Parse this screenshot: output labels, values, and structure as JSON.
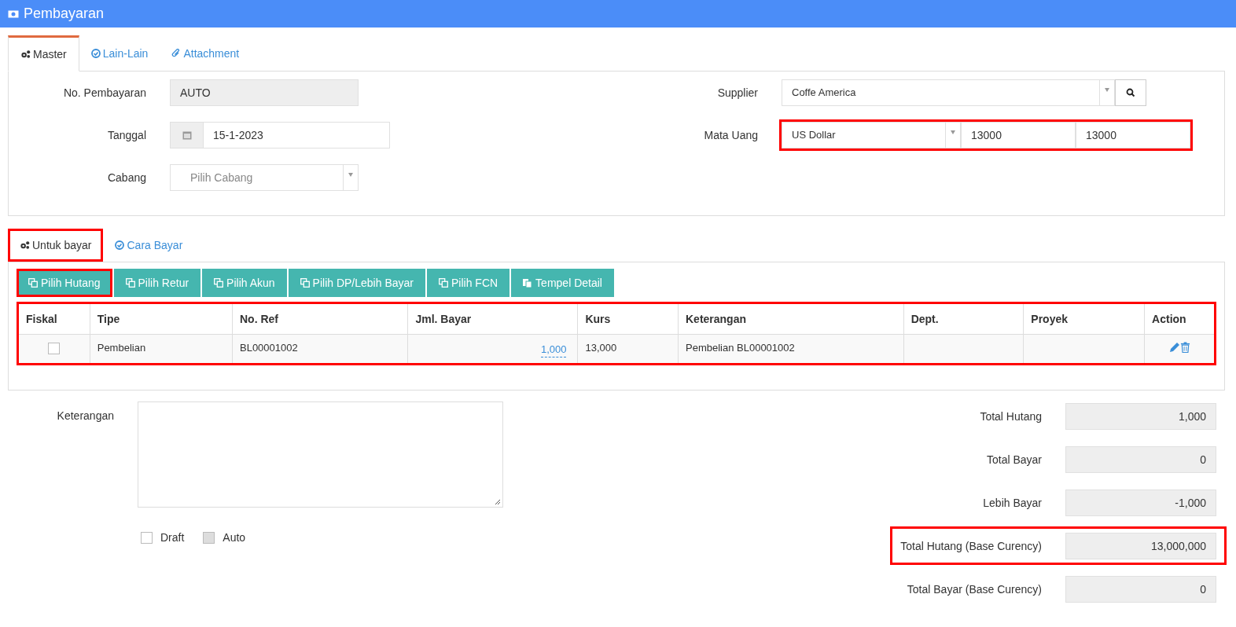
{
  "header": {
    "title": "Pembayaran"
  },
  "master_tabs": [
    {
      "label": "Master",
      "kind": "gears",
      "selected": true
    },
    {
      "label": "Lain-Lain",
      "kind": "check",
      "selected": false
    },
    {
      "label": "Attachment",
      "kind": "clip",
      "selected": false
    }
  ],
  "master": {
    "no_pembayaran": {
      "label": "No. Pembayaran",
      "value": "AUTO"
    },
    "tanggal": {
      "label": "Tanggal",
      "value": "15-1-2023"
    },
    "cabang": {
      "label": "Cabang",
      "placeholder": "Pilih Cabang"
    },
    "supplier": {
      "label": "Supplier",
      "value": "Coffe America"
    },
    "mata_uang": {
      "label": "Mata Uang",
      "currency": "US Dollar",
      "rate_1": "13000",
      "rate_2": "13000",
      "highlighted": true
    }
  },
  "detail_tabs": [
    {
      "label": "Untuk bayar",
      "kind": "gears",
      "selected": true,
      "highlighted": true
    },
    {
      "label": "Cara Bayar",
      "kind": "check",
      "selected": false,
      "highlighted": false
    }
  ],
  "toolbar": [
    {
      "label": "Pilih Hutang",
      "kind": "copy",
      "highlighted": true
    },
    {
      "label": "Pilih Retur",
      "kind": "copy",
      "highlighted": false
    },
    {
      "label": "Pilih Akun",
      "kind": "copy",
      "highlighted": false
    },
    {
      "label": "Pilih DP/Lebih Bayar",
      "kind": "copy",
      "highlighted": false
    },
    {
      "label": "Pilih FCN",
      "kind": "copy",
      "highlighted": false
    },
    {
      "label": "Tempel Detail",
      "kind": "paste",
      "highlighted": false
    }
  ],
  "table": {
    "highlighted": true,
    "columns": [
      "Fiskal",
      "Tipe",
      "No. Ref",
      "Jml. Bayar",
      "Kurs",
      "Keterangan",
      "Dept.",
      "Proyek",
      "Action"
    ],
    "rows": [
      {
        "fiskal_checked": false,
        "tipe": "Pembelian",
        "no_ref": "BL00001002",
        "jml_bayar": "1,000",
        "kurs": "13,000",
        "keterangan": "Pembelian BL00001002"
      }
    ]
  },
  "keterangan": {
    "label": "Keterangan"
  },
  "options": [
    {
      "label": "Draft",
      "checked": false,
      "disabled": false
    },
    {
      "label": "Auto",
      "checked": false,
      "disabled": true
    }
  ],
  "totals": [
    {
      "label": "Total Hutang",
      "value": "1,000",
      "highlighted": false
    },
    {
      "label": "Total Bayar",
      "value": "0",
      "highlighted": false
    },
    {
      "label": "Lebih Bayar",
      "value": "-1,000",
      "highlighted": false
    },
    {
      "label": "Total Hutang (Base Curency)",
      "value": "13,000,000",
      "highlighted": true
    },
    {
      "label": "Total Bayar (Base Curency)",
      "value": "0",
      "highlighted": false
    }
  ]
}
